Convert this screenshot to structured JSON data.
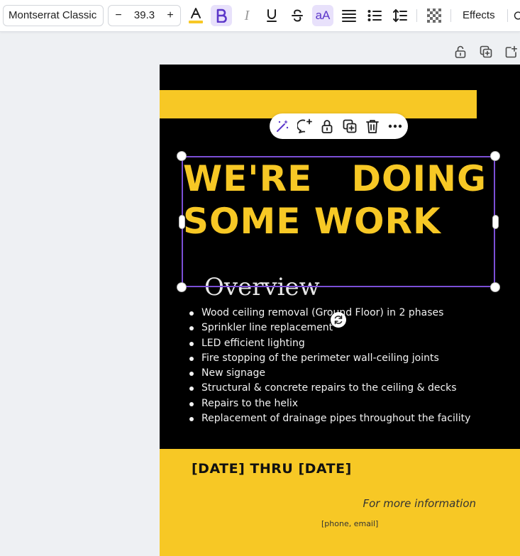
{
  "toolbar": {
    "font_name": "Montserrat Classic",
    "font_size": "39.3",
    "decrease_label": "−",
    "increase_label": "+",
    "italic_glyph": "I",
    "case_label": "aA",
    "effects_label": "Effects",
    "icons": [
      "text-color-icon",
      "bold-icon",
      "italic-icon",
      "underline-icon",
      "strikethrough-icon",
      "letter-case-icon",
      "align-icon",
      "list-icon",
      "spacing-icon",
      "transparency-icon"
    ],
    "text_color_underline": "#f7c825"
  },
  "page_tools": [
    "lock-icon",
    "duplicate-icon",
    "share-icon"
  ],
  "floating_toolbar": [
    "magic-edit-icon",
    "comment-icon",
    "lock-icon",
    "duplicate-icon",
    "trash-icon",
    "more-icon"
  ],
  "poster": {
    "headline": "WE'RE   DOING\nSOME WORK",
    "overview_heading": "Overview",
    "items": [
      "Wood ceiling removal (Ground Floor) in 2 phases",
      "Sprinkler line replacement",
      "LED efficient lighting",
      "Fire stopping of the perimeter wall-ceiling joints",
      "New signage",
      "Structural & concrete repairs to the ceiling & decks",
      "Repairs to the helix",
      "Replacement of drainage pipes throughout the facility"
    ],
    "dates": "[DATE] THRU [DATE]",
    "more_info": "For more information",
    "contact": "[phone, email]"
  },
  "colors": {
    "accent_yellow": "#f7c825",
    "selection_purple": "#7b4fd6",
    "page_black": "#000000"
  }
}
